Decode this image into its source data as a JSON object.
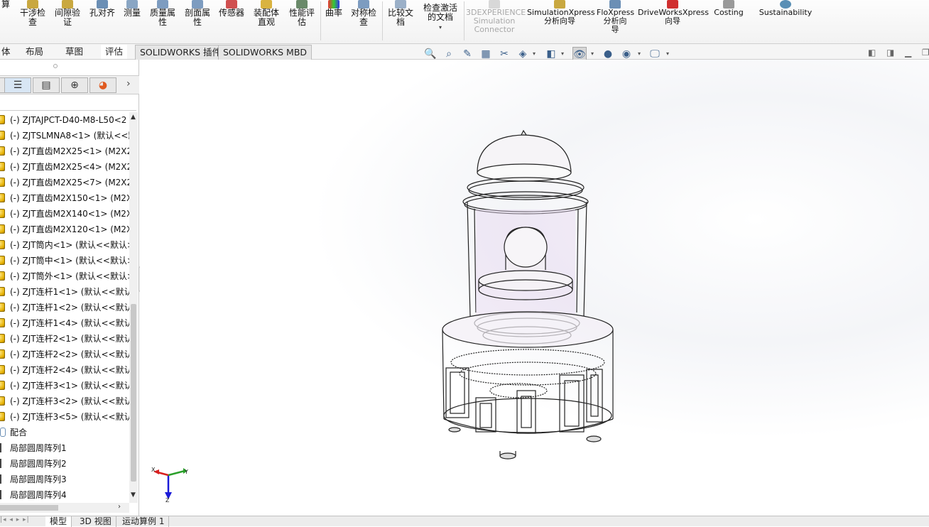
{
  "ribbon": {
    "buttons": [
      {
        "label": "算",
        "x_note": "partial"
      },
      {
        "label": "干涉检\n查"
      },
      {
        "label": "间隙验\n证"
      },
      {
        "label": "孔对齐"
      },
      {
        "label": "测量"
      },
      {
        "label": "质量属\n性"
      },
      {
        "label": "剖面属\n性"
      },
      {
        "label": "传感器"
      },
      {
        "label": "装配体\n直观"
      },
      {
        "label": "性能评\n估"
      },
      {
        "label": "曲率"
      },
      {
        "label": "对称检\n查"
      },
      {
        "label": "比较文\n档"
      },
      {
        "label": "检查激活\n的文档"
      },
      {
        "label": "3DEXPERIENCE\nSimulation\nConnector"
      },
      {
        "label": "SimulationXpress\n分析向导"
      },
      {
        "label": "FloXpress\n分析向\n导"
      },
      {
        "label": "DriveWorksXpress\n向导"
      },
      {
        "label": "Costing"
      },
      {
        "label": "Sustainability"
      }
    ]
  },
  "command_tabs": [
    "体",
    "布局",
    "草图",
    "评估",
    "SOLIDWORKS 插件",
    "SOLIDWORKS MBD"
  ],
  "panel": {
    "tabs": [
      "feature-manager",
      "property-manager",
      "configuration-manager",
      "display-manager"
    ],
    "tree": [
      {
        "label": "(-) ZJTAJPCT-D40-M8-L50<2",
        "type": "part"
      },
      {
        "label": "(-) ZJTSLMNA8<1> (默认<<默",
        "type": "part"
      },
      {
        "label": "(-) ZJT直齿M2X25<1> (M2X2",
        "type": "part"
      },
      {
        "label": "(-) ZJT直齿M2X25<4> (M2X2",
        "type": "part"
      },
      {
        "label": "(-) ZJT直齿M2X25<7> (M2X2",
        "type": "part"
      },
      {
        "label": "(-) ZJT直齿M2X150<1> (M2X",
        "type": "part"
      },
      {
        "label": "(-) ZJT直齿M2X140<1> (M2X",
        "type": "part"
      },
      {
        "label": "(-) ZJT直齿M2X120<1> (M2X",
        "type": "part"
      },
      {
        "label": "(-) ZJT筒内<1> (默认<<默认>",
        "type": "part"
      },
      {
        "label": "(-) ZJT筒中<1> (默认<<默认>",
        "type": "part"
      },
      {
        "label": "(-) ZJT筒外<1> (默认<<默认>",
        "type": "part"
      },
      {
        "label": "(-) ZJT连杆1<1> (默认<<默认",
        "type": "part"
      },
      {
        "label": "(-) ZJT连杆1<2> (默认<<默认",
        "type": "part"
      },
      {
        "label": "(-) ZJT连杆1<4> (默认<<默认",
        "type": "part"
      },
      {
        "label": "(-) ZJT连杆2<1> (默认<<默认",
        "type": "part"
      },
      {
        "label": "(-) ZJT连杆2<2> (默认<<默认",
        "type": "part"
      },
      {
        "label": "(-) ZJT连杆2<4> (默认<<默认",
        "type": "part"
      },
      {
        "label": "(-) ZJT连杆3<1> (默认<<默认",
        "type": "part"
      },
      {
        "label": "(-) ZJT连杆3<2> (默认<<默认",
        "type": "part"
      },
      {
        "label": "(-) ZJT连杆3<5> (默认<<默认",
        "type": "part"
      },
      {
        "label": "配合",
        "type": "mate"
      },
      {
        "label": "局部圆周阵列1",
        "type": "pattern"
      },
      {
        "label": "局部圆周阵列2",
        "type": "pattern"
      },
      {
        "label": "局部圆周阵列3",
        "type": "pattern"
      },
      {
        "label": "局部圆周阵列4",
        "type": "pattern"
      }
    ]
  },
  "triad": {
    "x": "X",
    "y": "Y",
    "z": "Z"
  },
  "bottom_tabs": [
    "模型",
    "3D 视图",
    "运动算例 1"
  ],
  "colors": {
    "accent": "#3a5f8a",
    "part_icon": "#e5b000"
  }
}
